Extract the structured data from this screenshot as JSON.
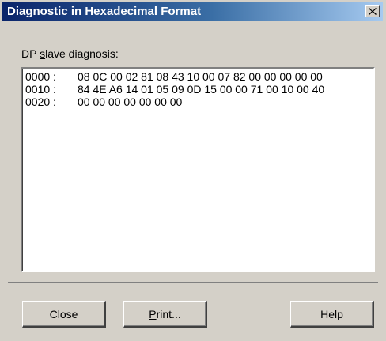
{
  "window": {
    "title": "Diagnostic in Hexadecimal Format",
    "close_icon": "close-icon"
  },
  "group": {
    "label_prefix": "DP ",
    "label_mnemonic": "s",
    "label_rest": "lave diagnosis:"
  },
  "hex_rows": [
    {
      "addr": "0000 :",
      "bytes": "08 0C 00 02 81 08 43 10 00 07 82 00 00 00 00 00"
    },
    {
      "addr": "0010 :",
      "bytes": "84 4E A6 14 01 05 09 0D 15 00 00 71 00 10 00 40"
    },
    {
      "addr": "0020 :",
      "bytes": "00 00 00 00 00 00 00"
    }
  ],
  "buttons": {
    "close_label": "Close",
    "print_mnemonic": "P",
    "print_rest": "rint...",
    "help_label": "Help"
  },
  "colors": {
    "titlebar_start": "#0a246a",
    "titlebar_end": "#a6caf0",
    "dialog_face": "#d4d0c8"
  }
}
